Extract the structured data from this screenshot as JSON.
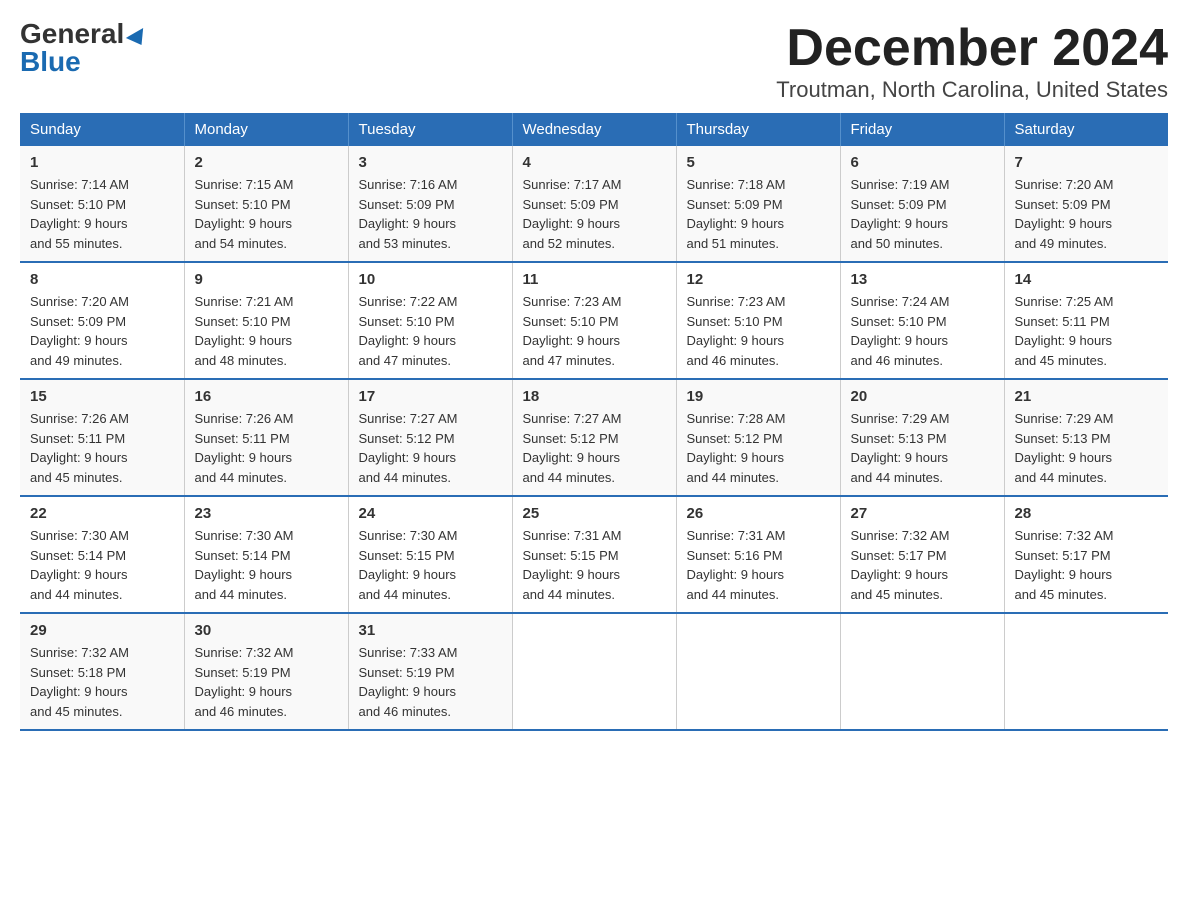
{
  "logo": {
    "general": "General",
    "blue": "Blue"
  },
  "header": {
    "month": "December 2024",
    "location": "Troutman, North Carolina, United States"
  },
  "weekdays": [
    "Sunday",
    "Monday",
    "Tuesday",
    "Wednesday",
    "Thursday",
    "Friday",
    "Saturday"
  ],
  "weeks": [
    [
      {
        "day": "1",
        "sunrise": "7:14 AM",
        "sunset": "5:10 PM",
        "daylight": "9 hours and 55 minutes."
      },
      {
        "day": "2",
        "sunrise": "7:15 AM",
        "sunset": "5:10 PM",
        "daylight": "9 hours and 54 minutes."
      },
      {
        "day": "3",
        "sunrise": "7:16 AM",
        "sunset": "5:09 PM",
        "daylight": "9 hours and 53 minutes."
      },
      {
        "day": "4",
        "sunrise": "7:17 AM",
        "sunset": "5:09 PM",
        "daylight": "9 hours and 52 minutes."
      },
      {
        "day": "5",
        "sunrise": "7:18 AM",
        "sunset": "5:09 PM",
        "daylight": "9 hours and 51 minutes."
      },
      {
        "day": "6",
        "sunrise": "7:19 AM",
        "sunset": "5:09 PM",
        "daylight": "9 hours and 50 minutes."
      },
      {
        "day": "7",
        "sunrise": "7:20 AM",
        "sunset": "5:09 PM",
        "daylight": "9 hours and 49 minutes."
      }
    ],
    [
      {
        "day": "8",
        "sunrise": "7:20 AM",
        "sunset": "5:09 PM",
        "daylight": "9 hours and 49 minutes."
      },
      {
        "day": "9",
        "sunrise": "7:21 AM",
        "sunset": "5:10 PM",
        "daylight": "9 hours and 48 minutes."
      },
      {
        "day": "10",
        "sunrise": "7:22 AM",
        "sunset": "5:10 PM",
        "daylight": "9 hours and 47 minutes."
      },
      {
        "day": "11",
        "sunrise": "7:23 AM",
        "sunset": "5:10 PM",
        "daylight": "9 hours and 47 minutes."
      },
      {
        "day": "12",
        "sunrise": "7:23 AM",
        "sunset": "5:10 PM",
        "daylight": "9 hours and 46 minutes."
      },
      {
        "day": "13",
        "sunrise": "7:24 AM",
        "sunset": "5:10 PM",
        "daylight": "9 hours and 46 minutes."
      },
      {
        "day": "14",
        "sunrise": "7:25 AM",
        "sunset": "5:11 PM",
        "daylight": "9 hours and 45 minutes."
      }
    ],
    [
      {
        "day": "15",
        "sunrise": "7:26 AM",
        "sunset": "5:11 PM",
        "daylight": "9 hours and 45 minutes."
      },
      {
        "day": "16",
        "sunrise": "7:26 AM",
        "sunset": "5:11 PM",
        "daylight": "9 hours and 44 minutes."
      },
      {
        "day": "17",
        "sunrise": "7:27 AM",
        "sunset": "5:12 PM",
        "daylight": "9 hours and 44 minutes."
      },
      {
        "day": "18",
        "sunrise": "7:27 AM",
        "sunset": "5:12 PM",
        "daylight": "9 hours and 44 minutes."
      },
      {
        "day": "19",
        "sunrise": "7:28 AM",
        "sunset": "5:12 PM",
        "daylight": "9 hours and 44 minutes."
      },
      {
        "day": "20",
        "sunrise": "7:29 AM",
        "sunset": "5:13 PM",
        "daylight": "9 hours and 44 minutes."
      },
      {
        "day": "21",
        "sunrise": "7:29 AM",
        "sunset": "5:13 PM",
        "daylight": "9 hours and 44 minutes."
      }
    ],
    [
      {
        "day": "22",
        "sunrise": "7:30 AM",
        "sunset": "5:14 PM",
        "daylight": "9 hours and 44 minutes."
      },
      {
        "day": "23",
        "sunrise": "7:30 AM",
        "sunset": "5:14 PM",
        "daylight": "9 hours and 44 minutes."
      },
      {
        "day": "24",
        "sunrise": "7:30 AM",
        "sunset": "5:15 PM",
        "daylight": "9 hours and 44 minutes."
      },
      {
        "day": "25",
        "sunrise": "7:31 AM",
        "sunset": "5:15 PM",
        "daylight": "9 hours and 44 minutes."
      },
      {
        "day": "26",
        "sunrise": "7:31 AM",
        "sunset": "5:16 PM",
        "daylight": "9 hours and 44 minutes."
      },
      {
        "day": "27",
        "sunrise": "7:32 AM",
        "sunset": "5:17 PM",
        "daylight": "9 hours and 45 minutes."
      },
      {
        "day": "28",
        "sunrise": "7:32 AM",
        "sunset": "5:17 PM",
        "daylight": "9 hours and 45 minutes."
      }
    ],
    [
      {
        "day": "29",
        "sunrise": "7:32 AM",
        "sunset": "5:18 PM",
        "daylight": "9 hours and 45 minutes."
      },
      {
        "day": "30",
        "sunrise": "7:32 AM",
        "sunset": "5:19 PM",
        "daylight": "9 hours and 46 minutes."
      },
      {
        "day": "31",
        "sunrise": "7:33 AM",
        "sunset": "5:19 PM",
        "daylight": "9 hours and 46 minutes."
      },
      null,
      null,
      null,
      null
    ]
  ],
  "labels": {
    "sunrise": "Sunrise:",
    "sunset": "Sunset:",
    "daylight": "Daylight:"
  }
}
